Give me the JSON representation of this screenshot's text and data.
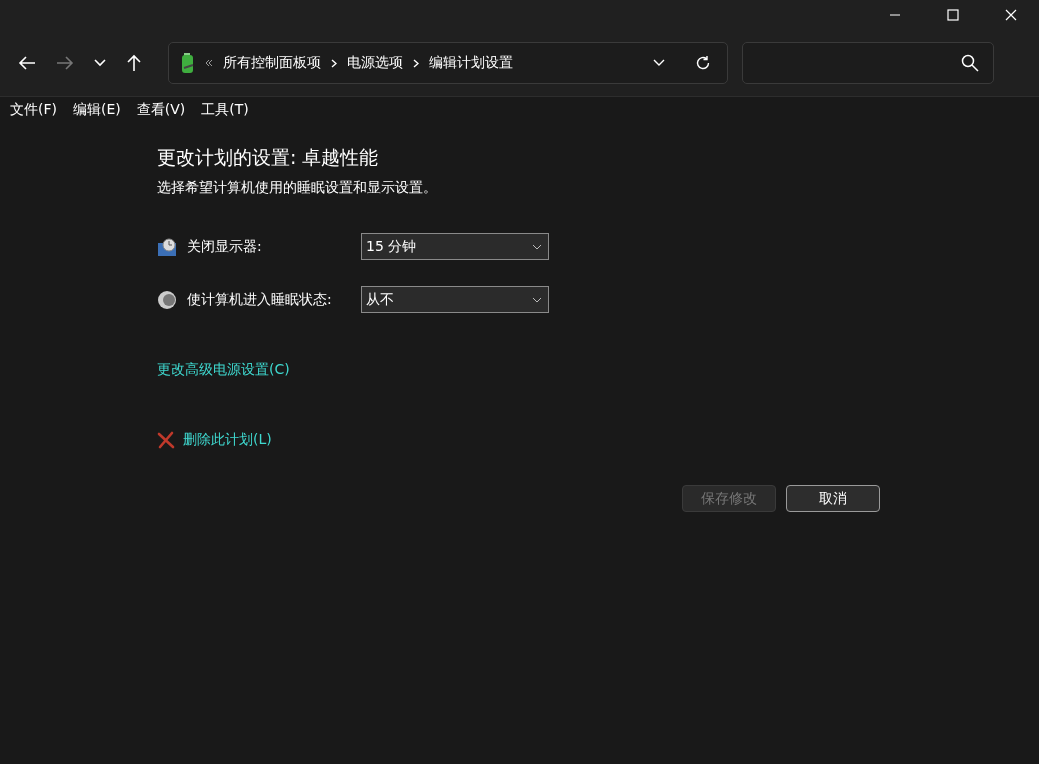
{
  "nav": {
    "back_disabled": false,
    "forward_disabled": true
  },
  "breadcrumb": [
    "所有控制面板项",
    "电源选项",
    "编辑计划设置"
  ],
  "menu": [
    "文件(F)",
    "编辑(E)",
    "查看(V)",
    "工具(T)"
  ],
  "heading": "更改计划的设置: 卓越性能",
  "subheading": "选择希望计算机使用的睡眠设置和显示设置。",
  "settings": [
    {
      "kind": "display",
      "label": "关闭显示器:",
      "value": "15 分钟"
    },
    {
      "kind": "sleep",
      "label": "使计算机进入睡眠状态:",
      "value": "从不"
    }
  ],
  "advanced_link": "更改高级电源设置(C)",
  "delete_link": "删除此计划(L)",
  "buttons": [
    {
      "label": "保存修改",
      "disabled": true
    },
    {
      "label": "取消",
      "disabled": false
    }
  ]
}
